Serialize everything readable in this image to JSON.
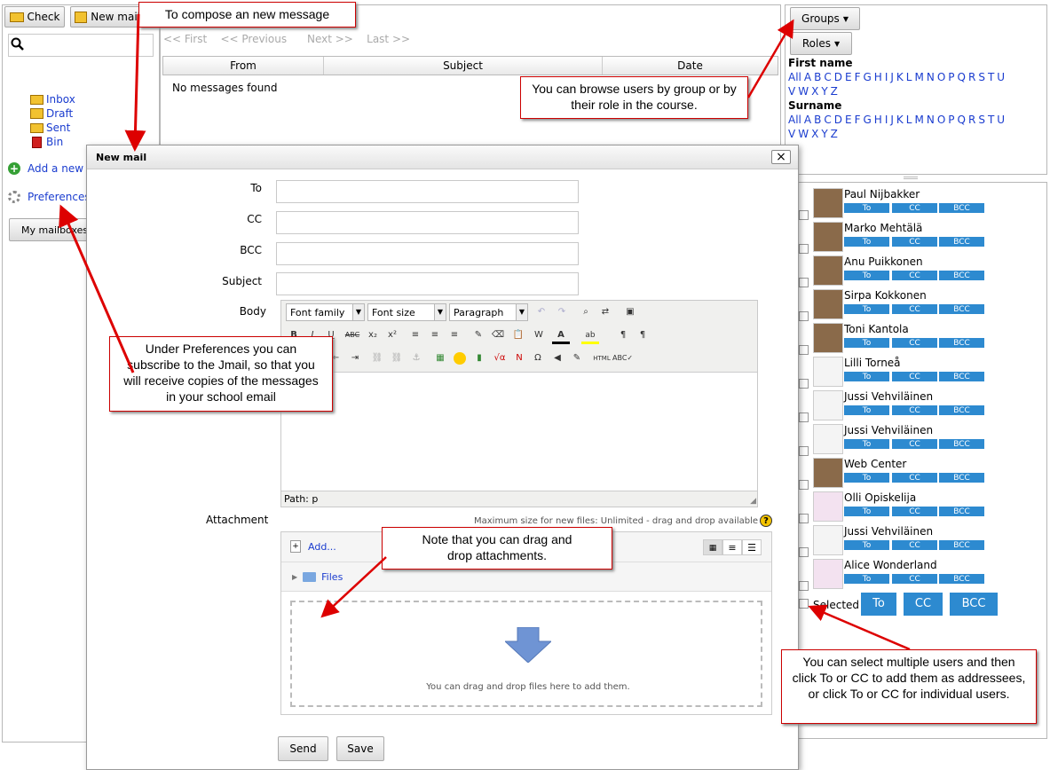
{
  "toolbar": {
    "check_label": "Check",
    "new_mail_label": "New mail"
  },
  "sidebar": {
    "folders": [
      {
        "label": "Inbox",
        "color": "#e8a000"
      },
      {
        "label": "Draft",
        "color": "#e8a000"
      },
      {
        "label": "Sent",
        "color": "#e8a000"
      },
      {
        "label": "Bin",
        "color": "#d02020"
      }
    ],
    "add_label": "Add a new",
    "preferences_label": "Preferences",
    "mailboxes_label": "My mailboxes"
  },
  "pager": {
    "first": "<< First",
    "previous": "<< Previous",
    "next": "Next >>",
    "last": "Last >>"
  },
  "message_table": {
    "columns": [
      "From",
      "Subject",
      "Date"
    ],
    "empty_text": "No messages found"
  },
  "filters": {
    "groups_label": "Groups",
    "roles_label": "Roles",
    "firstname_label": "First name",
    "surname_label": "Surname",
    "letters_row1": [
      "All",
      "A",
      "B",
      "C",
      "D",
      "E",
      "F",
      "G",
      "H",
      "I",
      "J",
      "K",
      "L",
      "M",
      "N",
      "O",
      "P",
      "Q",
      "R",
      "S",
      "T",
      "U"
    ],
    "letters_row2": [
      "V",
      "W",
      "X",
      "Y",
      "Z"
    ]
  },
  "users": [
    {
      "name": "Paul Nijbakker",
      "avatar": "photo"
    },
    {
      "name": "Marko Mehtälä",
      "avatar": "photo"
    },
    {
      "name": "Anu Puikkonen",
      "avatar": "photo"
    },
    {
      "name": "Sirpa Kokkonen",
      "avatar": "photo"
    },
    {
      "name": "Toni Kantola",
      "avatar": "photo"
    },
    {
      "name": "Lilli Torneå",
      "avatar": "default"
    },
    {
      "name": "Jussi Vehviläinen",
      "avatar": "default"
    },
    {
      "name": "Jussi Vehviläinen",
      "avatar": "default"
    },
    {
      "name": "Web Center",
      "avatar": "photo"
    },
    {
      "name": "Olli Opiskelija",
      "avatar": "drawing"
    },
    {
      "name": "Jussi Vehviläinen",
      "avatar": "default"
    },
    {
      "name": "Alice Wonderland",
      "avatar": "drawing"
    }
  ],
  "user_buttons": {
    "to": "To",
    "cc": "CC",
    "bcc": "BCC"
  },
  "selected": {
    "label": "Selected",
    "to": "To",
    "cc": "CC",
    "bcc": "BCC"
  },
  "dialog": {
    "title": "New mail",
    "close_glyph": "×",
    "labels": {
      "to": "To",
      "cc": "CC",
      "bcc": "BCC",
      "subject": "Subject",
      "body": "Body",
      "attachment": "Attachment"
    },
    "editor": {
      "font_family": "Font family",
      "font_size": "Font size",
      "paragraph": "Paragraph",
      "path": "Path: p"
    },
    "filepicker": {
      "max_size_note": "Maximum size for new files: Unlimited - drag and drop available",
      "add_label": "Add...",
      "files_label": "Files",
      "drop_text": "You can drag and drop files here to add them."
    },
    "send_label": "Send",
    "save_label": "Save"
  },
  "callouts": {
    "compose": "To compose an new message",
    "browse": "You can browse users by group or by their role in the course.",
    "preferences": "Under Preferences you can subscribe to the Jmail, so that you will receive copies of the messages in your school email",
    "dragdrop": "Note that you can drag and drop attachments.",
    "multiselect": "You can select multiple users and then click To or CC to add them as addressees, or click To or CC for individual users."
  },
  "colors": {
    "link": "#1a3ccf",
    "user_button": "#2d8ad0",
    "callout_border": "#cc0000",
    "arrow": "#dd0000"
  }
}
